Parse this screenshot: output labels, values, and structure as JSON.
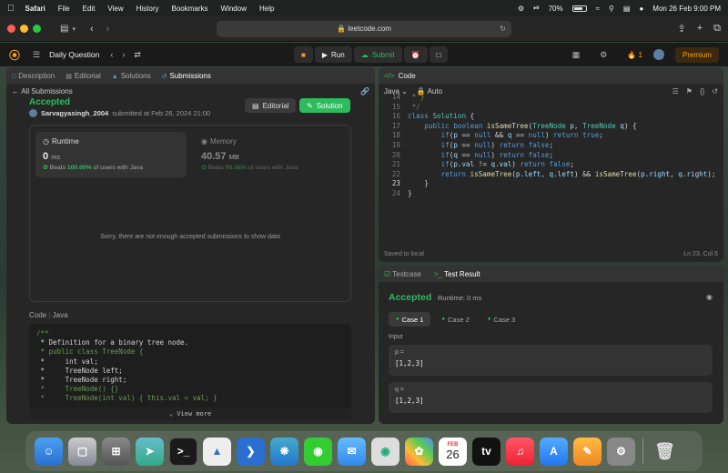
{
  "menubar": {
    "app": "Safari",
    "menus": [
      "File",
      "Edit",
      "View",
      "History",
      "Bookmarks",
      "Window",
      "Help"
    ],
    "battery": "70%",
    "datetime": "Mon 26 Feb  9:00 PM"
  },
  "browser": {
    "url": "leetcode.com"
  },
  "lc_nav": {
    "daily_label": "Daily Question",
    "run_label": "Run",
    "submit_label": "Submit",
    "streak": "1",
    "premium_label": "Premium"
  },
  "left_tabs": [
    "Description",
    "Editorial",
    "Solutions",
    "Submissions"
  ],
  "back_label": "All Submissions",
  "submission": {
    "status": "Accepted",
    "user": "Sarvagyasingh_2004",
    "submitted_text": "submitted at Feb 26, 2024 21:00",
    "editorial_btn": "Editorial",
    "solution_btn": "Solution"
  },
  "stats": {
    "runtime_title": "Runtime",
    "runtime_value": "0",
    "runtime_unit": "ms",
    "runtime_beats_pre": "Beats",
    "runtime_beats_pct": "100.00%",
    "runtime_beats_post": "of users with Java",
    "memory_title": "Memory",
    "memory_value": "40.57",
    "memory_unit": "MB",
    "memory_beats_pre": "Beats",
    "memory_beats_pct": "95.58%",
    "memory_beats_post": "of users with Java",
    "empty_message": "Sorry, there are not enough accepted submissions to show data"
  },
  "code_section": {
    "label": "Code",
    "lang": "Java",
    "lines": [
      "/**",
      " * Definition for a binary tree node.",
      " * public class TreeNode {",
      " *     int val;",
      " *     TreeNode left;",
      " *     TreeNode right;",
      " *     TreeNode() {}",
      " *     TreeNode(int val) { this.val = val; }"
    ],
    "view_more": "View more"
  },
  "editor": {
    "title": "Code",
    "language": "Java",
    "auto_label": "Auto",
    "line_numbers": [
      "14",
      "15",
      "16",
      "17",
      "18",
      "19",
      "20",
      "21",
      "22",
      "23",
      "24"
    ],
    "saved": "Saved to local",
    "position": "Ln 23, Col 6"
  },
  "test_panel": {
    "tab_testcase": "Testcase",
    "tab_result": "Test Result",
    "status": "Accepted",
    "runtime": "Runtime: 0 ms",
    "cases": [
      "Case 1",
      "Case 2",
      "Case 3"
    ],
    "input_label": "Input",
    "p_label": "p =",
    "p_value": "[1,2,3]",
    "q_label": "q =",
    "q_value": "[1,2,3]"
  },
  "dock": {
    "calendar_month": "FEB",
    "calendar_day": "26"
  }
}
